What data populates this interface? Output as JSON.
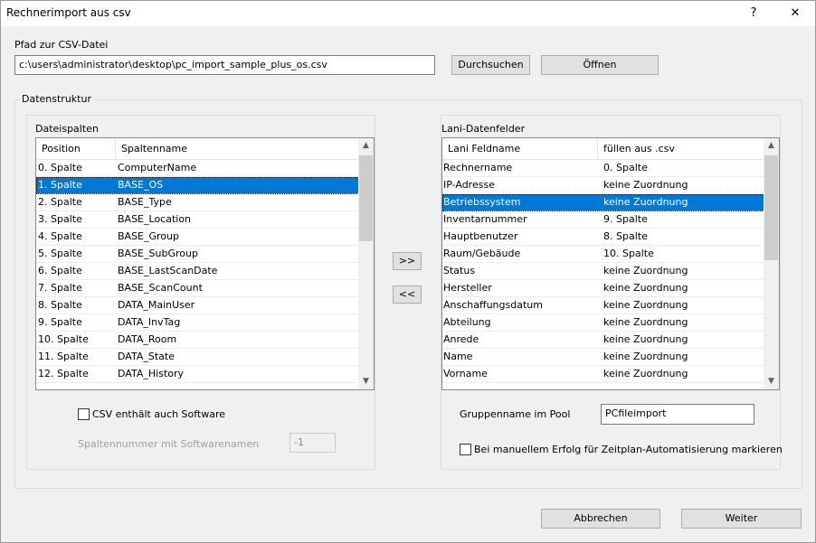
{
  "window": {
    "title": "Rechnerimport aus csv",
    "help_label": "?",
    "close_label": "✕"
  },
  "path": {
    "label": "Pfad zur CSV-Datei",
    "value": "c:\\users\\administrator\\desktop\\pc_import_sample_plus_os.csv",
    "browse_label": "Durchsuchen",
    "open_label": "Öffnen"
  },
  "datastructure": {
    "label": "Datenstruktur"
  },
  "file_columns": {
    "label": "Dateispalten",
    "headers": [
      "Position",
      "Spaltenname"
    ],
    "rows": [
      {
        "position": "0. Spalte",
        "name": "ComputerName"
      },
      {
        "position": "1. Spalte",
        "name": "BASE_OS"
      },
      {
        "position": "2. Spalte",
        "name": "BASE_Type"
      },
      {
        "position": "3. Spalte",
        "name": "BASE_Location"
      },
      {
        "position": "4. Spalte",
        "name": "BASE_Group"
      },
      {
        "position": "5. Spalte",
        "name": "BASE_SubGroup"
      },
      {
        "position": "6. Spalte",
        "name": "BASE_LastScanDate"
      },
      {
        "position": "7. Spalte",
        "name": "BASE_ScanCount"
      },
      {
        "position": "8. Spalte",
        "name": "DATA_MainUser"
      },
      {
        "position": "9. Spalte",
        "name": "DATA_InvTag"
      },
      {
        "position": "10. Spalte",
        "name": "DATA_Room"
      },
      {
        "position": "11. Spalte",
        "name": "DATA_State"
      },
      {
        "position": "12. Spalte",
        "name": "DATA_History"
      }
    ],
    "selected_index": 1
  },
  "transfer": {
    "add_label": ">>",
    "remove_label": "<<"
  },
  "lani_fields": {
    "label": "Lani-Datenfelder",
    "headers": [
      "Lani Feldname",
      "füllen aus .csv"
    ],
    "rows": [
      {
        "field": "Rechnername",
        "source": "0. Spalte"
      },
      {
        "field": "IP-Adresse",
        "source": "keine Zuordnung"
      },
      {
        "field": "Betriebssystem",
        "source": "keine Zuordnung"
      },
      {
        "field": "Inventarnummer",
        "source": "9. Spalte"
      },
      {
        "field": "Hauptbenutzer",
        "source": "8. Spalte"
      },
      {
        "field": "Raum/Gebäude",
        "source": "10. Spalte"
      },
      {
        "field": "Status",
        "source": "keine Zuordnung"
      },
      {
        "field": "Hersteller",
        "source": "keine Zuordnung"
      },
      {
        "field": "Anschaffungsdatum",
        "source": "keine Zuordnung"
      },
      {
        "field": "Abteilung",
        "source": "keine Zuordnung"
      },
      {
        "field": "Anrede",
        "source": "keine Zuordnung"
      },
      {
        "field": "Name",
        "source": "keine Zuordnung"
      },
      {
        "field": "Vorname",
        "source": "keine Zuordnung"
      }
    ],
    "selected_index": 2
  },
  "software": {
    "checkbox_label": "CSV enthält auch Software",
    "checked": false,
    "column_label": "Spaltennummer mit Softwarenamen",
    "column_value": "-1"
  },
  "pool": {
    "label": "Gruppenname im Pool",
    "value": "PCfileimport",
    "schedule_label": "Bei manuellem Erfolg für Zeitplan-Automatisierung markieren",
    "schedule_checked": false
  },
  "footer": {
    "cancel_label": "Abbrechen",
    "next_label": "Weiter"
  },
  "colors": {
    "selection": "#0078d7",
    "window_bg": "#f0f0f0"
  }
}
